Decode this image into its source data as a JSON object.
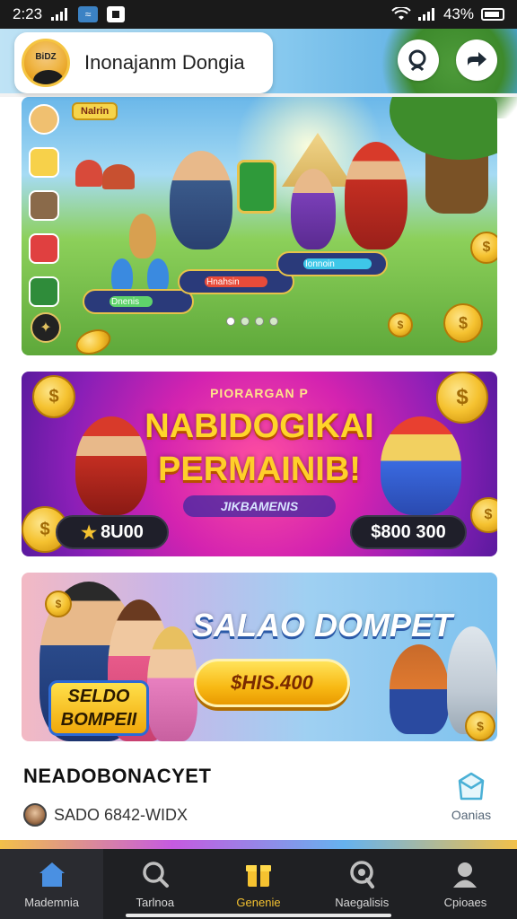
{
  "status_bar": {
    "time": "2:23",
    "battery": "43%"
  },
  "header": {
    "title": "Inonajanm Dongia",
    "avatar_text": "BiDZ",
    "search_icon": "search-icon",
    "share_icon": "share-arrow-icon"
  },
  "hero_banner": {
    "badge": "Nalrin",
    "bars": [
      {
        "label": "Dnenis",
        "fill": 0.55,
        "color": "#5fd36b"
      },
      {
        "label": "Hnahsin",
        "fill": 0.7,
        "color": "#e84b3a"
      },
      {
        "label": "Ionnoin",
        "fill": 0.8,
        "color": "#3ec7e8"
      }
    ],
    "carousel": {
      "total": 4,
      "active": 0
    }
  },
  "promo_banner": {
    "subtitle": "PIORARGAN P",
    "title_line1": "NABIDOGIKAI",
    "title_line2": "PERMAINIB!",
    "tag": "JIKBAMENIS",
    "left_value": "8U00",
    "right_value": "$800 300",
    "coin_symbol": "$"
  },
  "wallet_banner": {
    "title": "SALAO DOMPET",
    "button_label": "$HIS.400",
    "badge_line1": "SELDO",
    "badge_line2": "BOMPEII"
  },
  "info": {
    "title": "NEADOBONACYET",
    "meta": "SADO 6842-WIDX",
    "gift_label": "Oanias"
  },
  "bottom_nav": {
    "items": [
      {
        "label": "Mademnia",
        "icon": "home-icon"
      },
      {
        "label": "Tarlnoa",
        "icon": "search-icon"
      },
      {
        "label": "Genenie",
        "icon": "gift-box-icon"
      },
      {
        "label": "Naegalisis",
        "icon": "search-icon"
      },
      {
        "label": "Cpioaes",
        "icon": "profile-icon"
      }
    ],
    "active_index": 0
  },
  "colors": {
    "accent": "#f5c230",
    "nav_bg": "#1f2023",
    "home_blue": "#4a90e2"
  }
}
